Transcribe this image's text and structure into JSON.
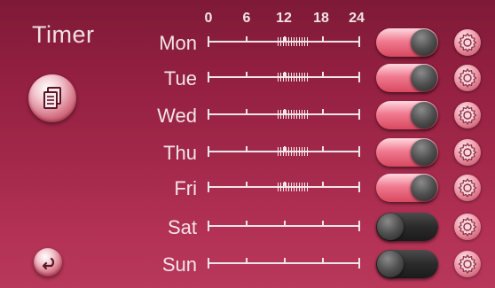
{
  "title": "Timer",
  "scale": [
    "0",
    "6",
    "12",
    "18",
    "24"
  ],
  "days": [
    {
      "label": "Mon",
      "enabled": true,
      "schedule": [
        11,
        16
      ]
    },
    {
      "label": "Tue",
      "enabled": true,
      "schedule": [
        11,
        16
      ]
    },
    {
      "label": "Wed",
      "enabled": true,
      "schedule": [
        11,
        16
      ]
    },
    {
      "label": "Thu",
      "enabled": true,
      "schedule": [
        11,
        16
      ]
    },
    {
      "label": "Fri",
      "enabled": true,
      "schedule": [
        11,
        16
      ]
    },
    {
      "label": "Sat",
      "enabled": false,
      "schedule": null
    },
    {
      "label": "Sun",
      "enabled": false,
      "schedule": null
    }
  ],
  "icons": {
    "copy": "copy-icon",
    "back": "back-arrow-icon",
    "settings": "gear-icon"
  },
  "colors": {
    "toggle_on": "#e8647b",
    "toggle_off": "#2a2a2a",
    "background_top": "#7d1a37",
    "background_bottom": "#b8385b"
  }
}
